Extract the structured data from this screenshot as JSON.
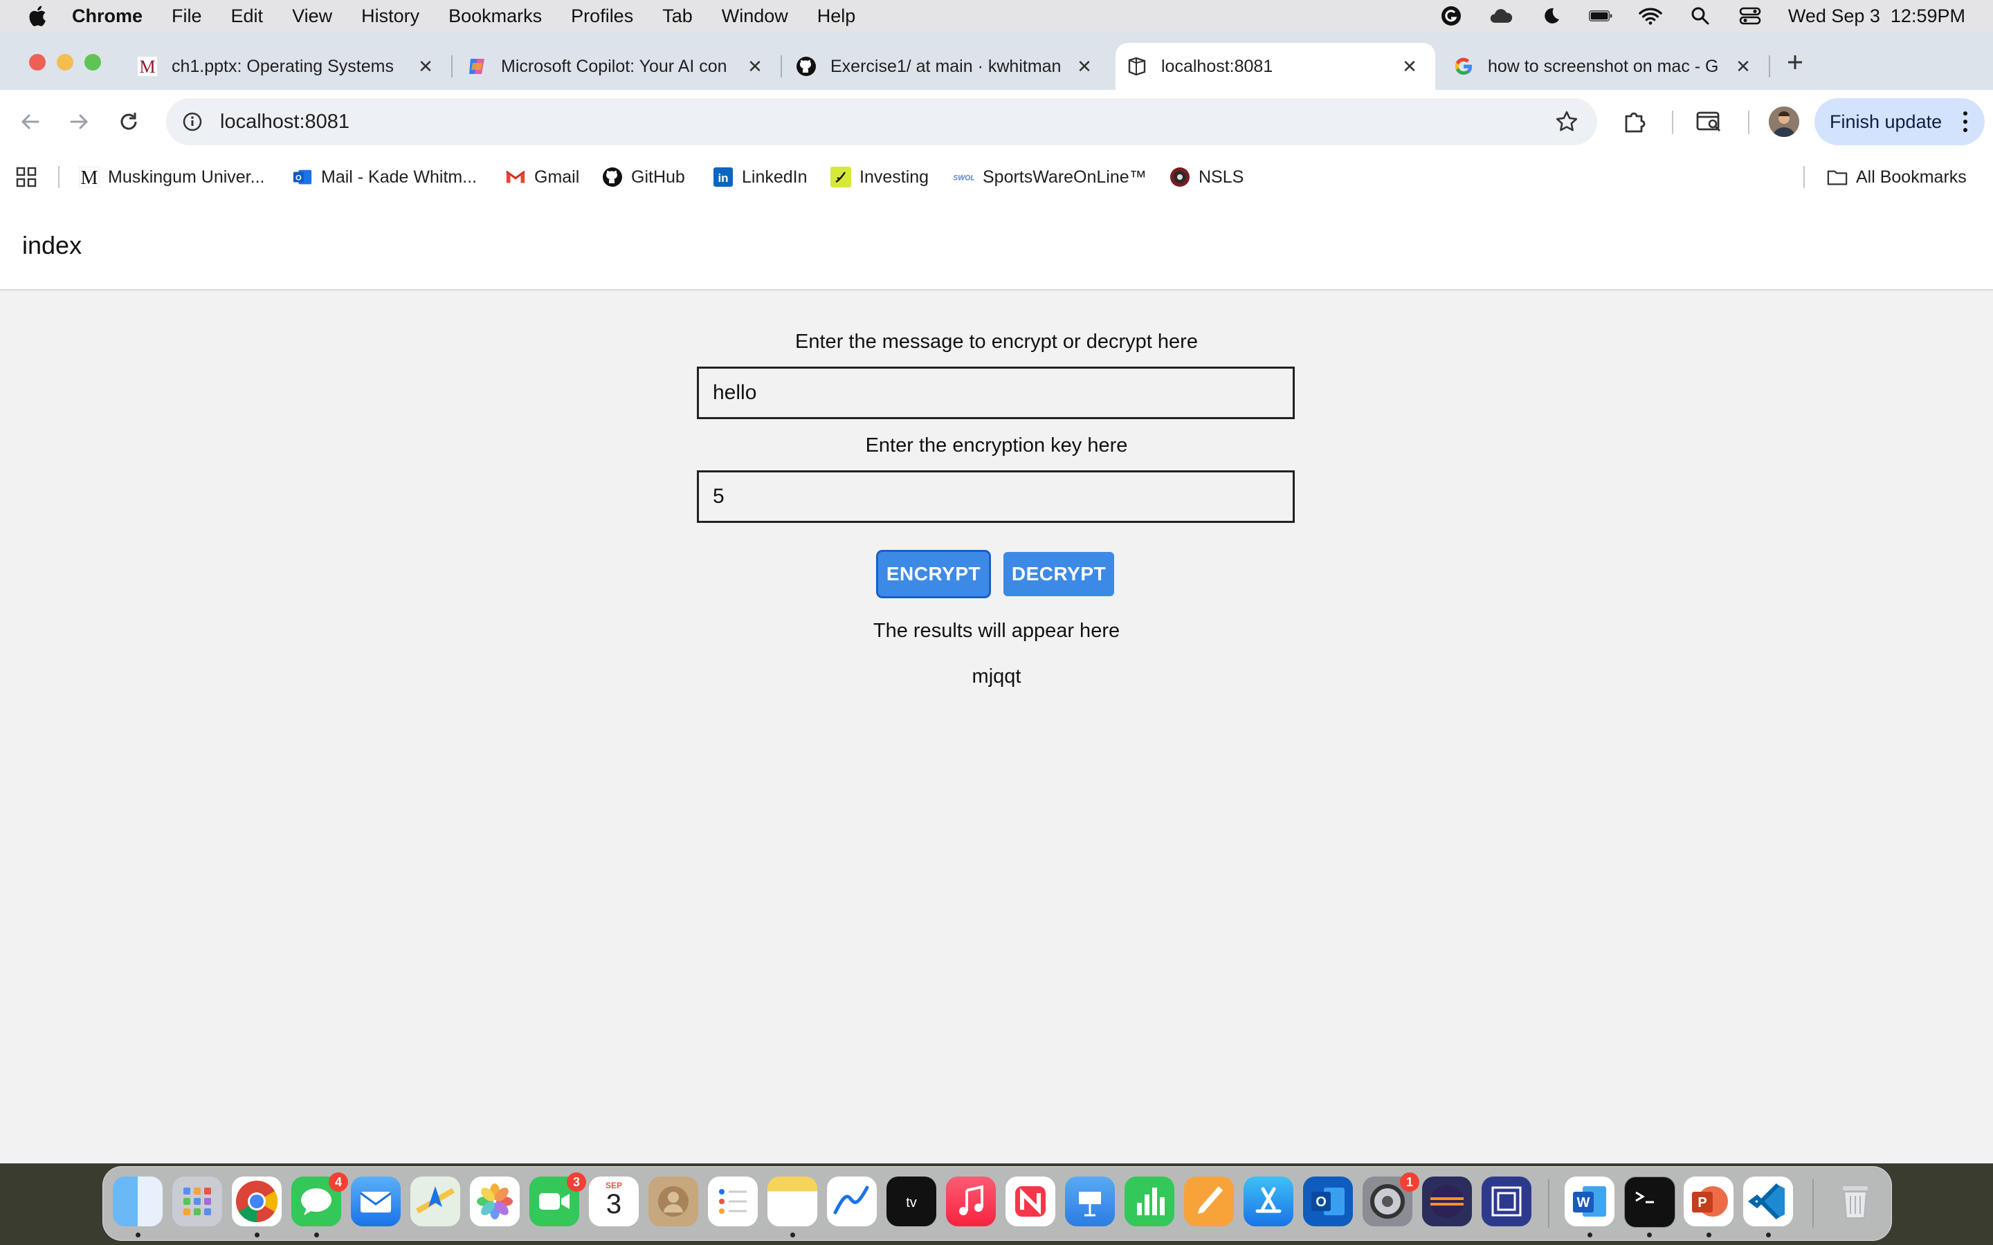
{
  "menubar": {
    "app": "Chrome",
    "items": [
      "File",
      "Edit",
      "View",
      "History",
      "Bookmarks",
      "Profiles",
      "Tab",
      "Window",
      "Help"
    ],
    "clock": "Wed Sep 3  12:59PM"
  },
  "tabs": [
    {
      "title": "ch1.pptx: Operating Systems",
      "icon": "muskingum-icon"
    },
    {
      "title": "Microsoft Copilot: Your AI con",
      "icon": "copilot-icon"
    },
    {
      "title": "Exercise1/ at main · kwhitman",
      "icon": "github-icon"
    },
    {
      "title": "localhost:8081",
      "icon": "page-icon",
      "active": true
    },
    {
      "title": "how to screenshot on mac - G",
      "icon": "google-icon"
    }
  ],
  "toolbar": {
    "url": "localhost:8081",
    "finish_update": "Finish update"
  },
  "bookmarks": {
    "items": [
      {
        "label": "Muskingum Univer..."
      },
      {
        "label": "Mail - Kade Whitm..."
      },
      {
        "label": "Gmail"
      },
      {
        "label": "GitHub"
      },
      {
        "label": "LinkedIn"
      },
      {
        "label": "Investing"
      },
      {
        "label": "SportsWareOnLine™"
      },
      {
        "label": "NSLS"
      }
    ],
    "all": "All Bookmarks"
  },
  "page": {
    "title": "index",
    "message_label": "Enter the message to encrypt or decrypt here",
    "message_value": "hello",
    "key_label": "Enter the encryption key here",
    "key_value": "5",
    "encrypt_label": "ENCRYPT",
    "decrypt_label": "DECRYPT",
    "results_label": "The results will appear here",
    "result": "mjqqt"
  },
  "dock": {
    "badges": {
      "messages": "4",
      "facetime": "3",
      "settings": "1"
    },
    "calendar": {
      "month": "SEP",
      "day": "3"
    }
  },
  "colors": {
    "accent_button": "#3d8ae6",
    "page_bg": "#f2f2f2",
    "finish_update_bg": "#d3e3fd"
  }
}
